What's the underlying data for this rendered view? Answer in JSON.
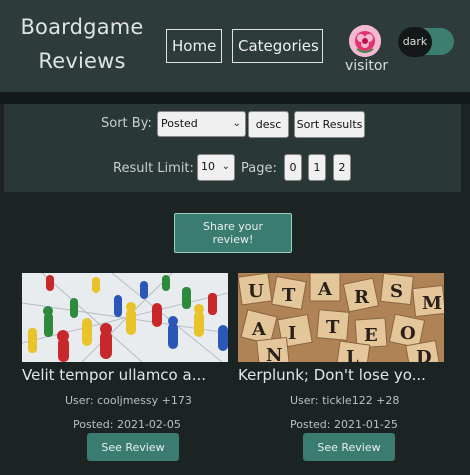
{
  "header": {
    "site_title": "Boardgame Reviews",
    "nav": {
      "home": "Home",
      "categories": "Categories"
    },
    "user": {
      "name": "visitor",
      "avatar_icon": "flower-avatar-icon"
    },
    "theme_toggle": {
      "label": "dark",
      "state": "dark"
    }
  },
  "controls": {
    "sort_label": "Sort By:",
    "sort_value": "Posted",
    "order_button": "desc",
    "sort_button": "Sort Results",
    "limit_label": "Result Limit:",
    "limit_value": "10",
    "page_label": "Page:",
    "pages": [
      "0",
      "1",
      "2"
    ]
  },
  "share_button": "Share your review!",
  "reviews": [
    {
      "title": "Velit tempor ullamco a...",
      "user_line": "User: cooljmessy +173",
      "posted_line": "Posted: 2021-02-05",
      "button": "See Review",
      "image": "board-game-pawns-image"
    },
    {
      "title": "Kerplunk; Don't lose yo...",
      "user_line": "User: tickle122 +28",
      "posted_line": "Posted: 2021-01-25",
      "button": "See Review",
      "image": "letter-tiles-image"
    }
  ],
  "colors": {
    "background": "#1c2323",
    "header": "#2d3b3b",
    "accent": "#3a7d70"
  }
}
